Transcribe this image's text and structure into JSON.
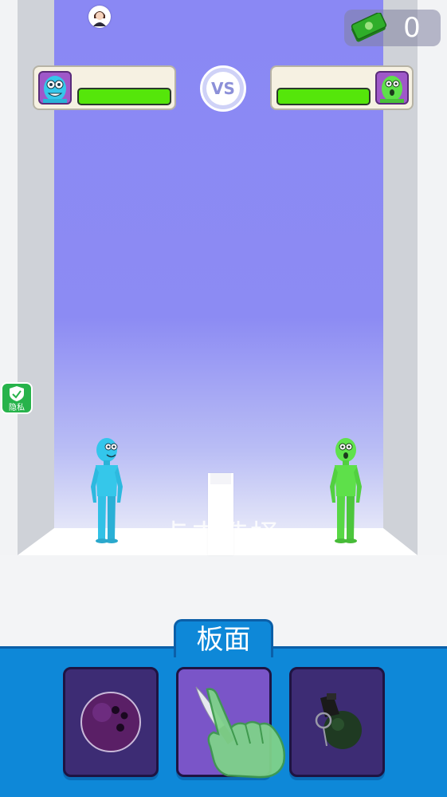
{
  "currency": {
    "value": "0",
    "icon": "cash-icon",
    "color": "#2fae2a"
  },
  "hud": {
    "player": {
      "name": "blue-fighter",
      "color": "#35c7ea",
      "health_fraction": 1.0
    },
    "opponent": {
      "name": "green-fighter",
      "color": "#5ee04a",
      "health_fraction": 1.0
    },
    "vs_label": "VS"
  },
  "scene": {
    "tap_hint": "点击选择",
    "wall_color": "#8a88f4"
  },
  "privacy_badge": {
    "label": "隐私",
    "icon": "shield-check-icon"
  },
  "panel": {
    "title": "板面",
    "items": [
      {
        "name": "bowling-ball",
        "icon": "bowling-ball-icon",
        "selected": false
      },
      {
        "name": "knife",
        "icon": "knife-icon",
        "selected": true
      },
      {
        "name": "grenade",
        "icon": "grenade-icon",
        "selected": false
      }
    ]
  }
}
